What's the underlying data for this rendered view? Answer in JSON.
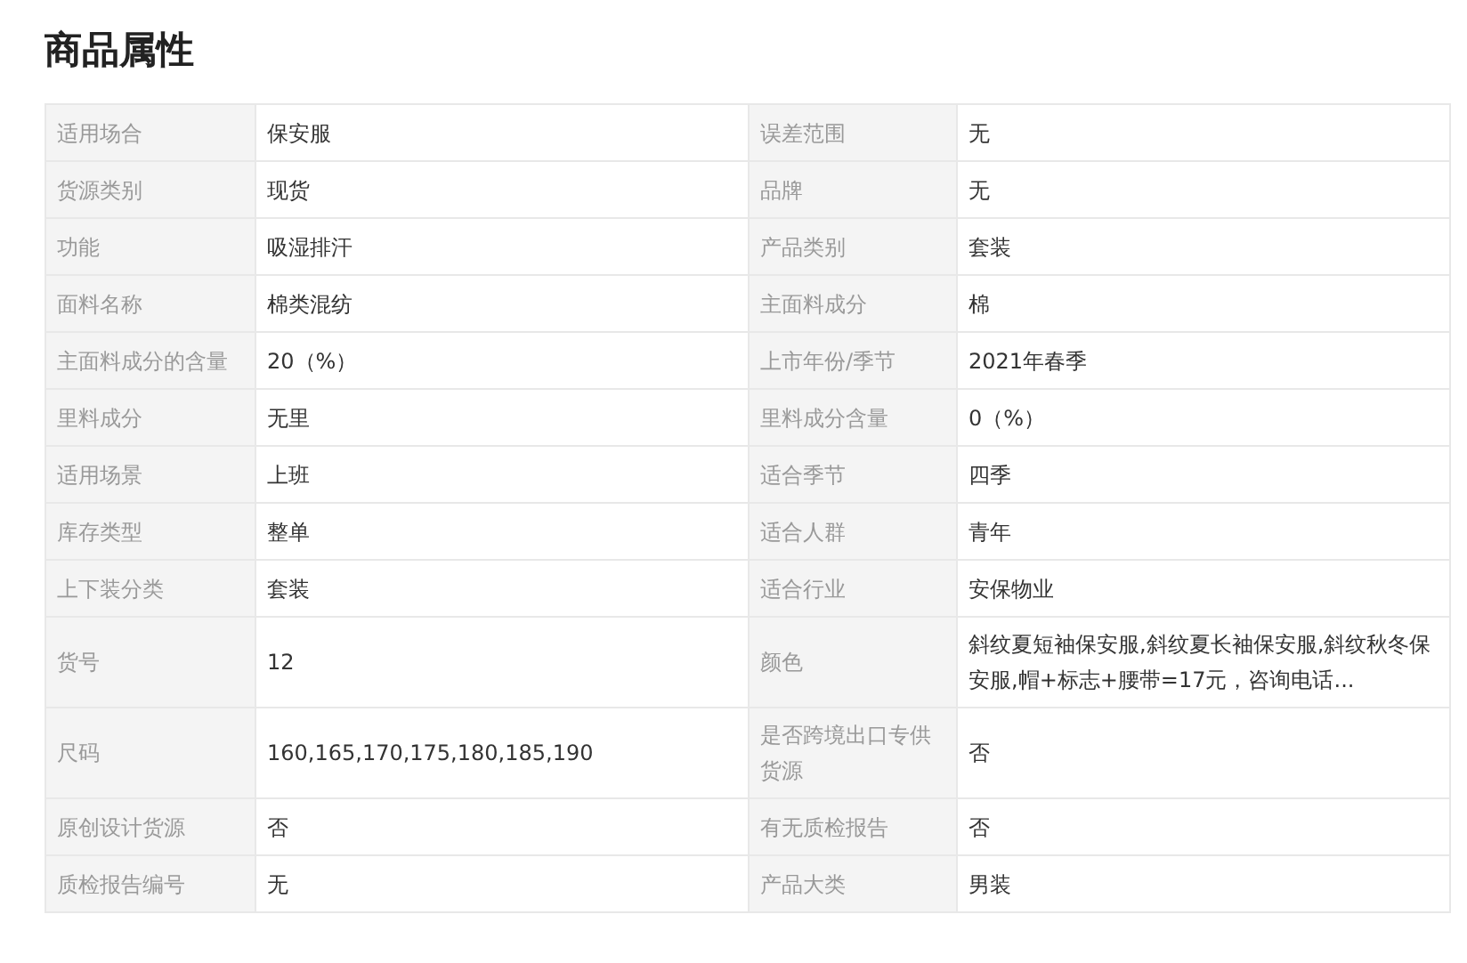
{
  "title": "商品属性",
  "rows": [
    [
      {
        "label": "适用场合",
        "value": "保安服"
      },
      {
        "label": "误差范围",
        "value": "无"
      }
    ],
    [
      {
        "label": "货源类别",
        "value": "现货"
      },
      {
        "label": "品牌",
        "value": "无"
      }
    ],
    [
      {
        "label": "功能",
        "value": "吸湿排汗"
      },
      {
        "label": "产品类别",
        "value": "套装"
      }
    ],
    [
      {
        "label": "面料名称",
        "value": "棉类混纺"
      },
      {
        "label": "主面料成分",
        "value": "棉"
      }
    ],
    [
      {
        "label": "主面料成分的含量",
        "value": "20（%）"
      },
      {
        "label": "上市年份/季节",
        "value": "2021年春季"
      }
    ],
    [
      {
        "label": "里料成分",
        "value": "无里"
      },
      {
        "label": "里料成分含量",
        "value": "0（%）"
      }
    ],
    [
      {
        "label": "适用场景",
        "value": "上班"
      },
      {
        "label": "适合季节",
        "value": "四季"
      }
    ],
    [
      {
        "label": "库存类型",
        "value": "整单"
      },
      {
        "label": "适合人群",
        "value": "青年"
      }
    ],
    [
      {
        "label": "上下装分类",
        "value": "套装"
      },
      {
        "label": "适合行业",
        "value": "安保物业"
      }
    ],
    [
      {
        "label": "货号",
        "value": "12"
      },
      {
        "label": "颜色",
        "value": "斜纹夏短袖保安服,斜纹夏长袖保安服,斜纹秋冬保安服,帽+标志+腰带=17元，咨询电话..."
      }
    ],
    [
      {
        "label": "尺码",
        "value": "160,165,170,175,180,185,190"
      },
      {
        "label": "是否跨境出口专供货源",
        "value": "否"
      }
    ],
    [
      {
        "label": "原创设计货源",
        "value": "否"
      },
      {
        "label": "有无质检报告",
        "value": "否"
      }
    ],
    [
      {
        "label": "质检报告编号",
        "value": "无"
      },
      {
        "label": "产品大类",
        "value": "男装"
      }
    ]
  ]
}
